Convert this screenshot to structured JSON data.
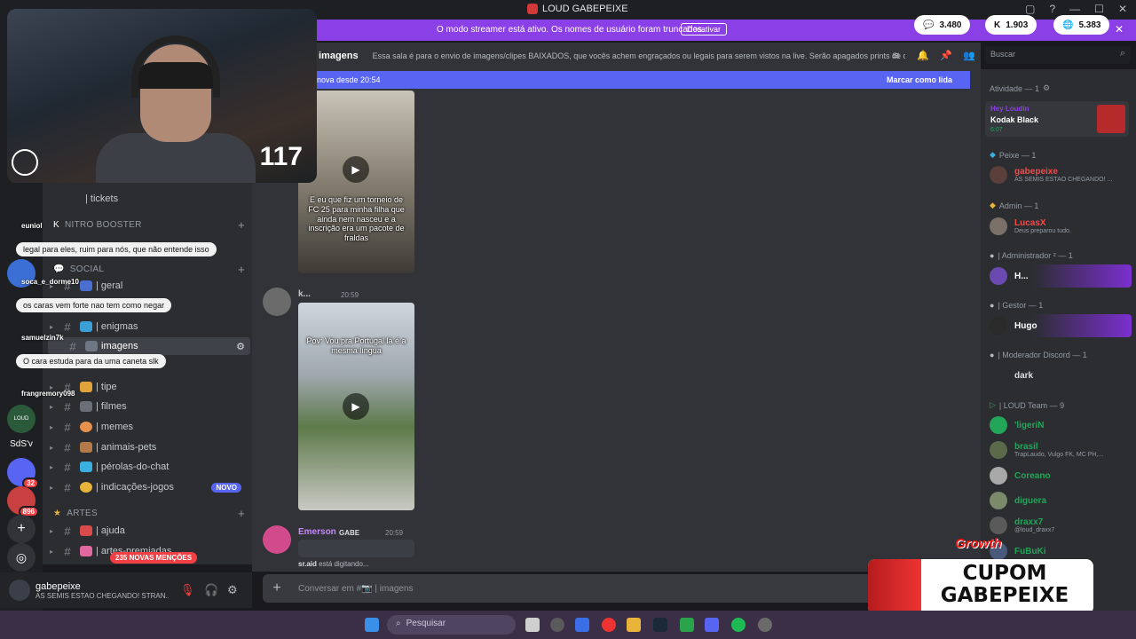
{
  "window": {
    "title": "LOUD GABEPEIXE"
  },
  "streamer_banner": {
    "message": "O modo streamer está ativo. Os nomes de usuário foram truncados.",
    "button": "Desativar"
  },
  "stats": [
    {
      "icon": "chat-icon",
      "value": "3.480"
    },
    {
      "icon": "kick-icon",
      "value": "1.903"
    },
    {
      "icon": "globe-icon",
      "value": "5.383"
    }
  ],
  "webcam": {
    "viewer_count": "117"
  },
  "channel_header": {
    "name": "imagens",
    "topic": "Essa sala é para o envio de imagens/clipes BAIXADOS, que vocês achem engraçados ou legais para serem vistos na live. Serão apagados prints de o..."
  },
  "search": {
    "placeholder": "Buscar"
  },
  "new_messages_bar": {
    "left": "nova desde 20:54",
    "right": "Marcar como lida"
  },
  "sidebar": {
    "tickets": "| tickets",
    "categories": {
      "nitro": "NITRO BOOSTER",
      "social": "SOCIAL",
      "artes": "ARTES"
    },
    "channels": [
      {
        "name": "| geral"
      },
      {
        "name": "| enigmas"
      },
      {
        "name": "imagens"
      },
      {
        "name": "| tipe"
      },
      {
        "name": "| filmes"
      },
      {
        "name": "| memes"
      },
      {
        "name": "| animais-pets"
      },
      {
        "name": "| pérolas-do-chat"
      },
      {
        "name": "| indicações-jogos",
        "badge": "NOVO"
      },
      {
        "name": "| ajuda"
      },
      {
        "name": "| artes-premiadas"
      }
    ],
    "mentions": "235 NOVAS MENÇÕES"
  },
  "server_badges": {
    "a": "32",
    "b": "896"
  },
  "server_labels": {
    "sdsv": "SdS'v",
    "loud": "LOUD"
  },
  "chat_overlay": [
    {
      "user": "euniol",
      "message": "legal para eles, ruim para nós, que não entende isso"
    },
    {
      "user": "soca_e_dorme10",
      "message": "os caras vem forte nao tem como negar"
    },
    {
      "user": "samuelzin7k",
      "message": "O cara estuda para da uma caneta slk"
    },
    {
      "user": "frangremory098",
      "message": ""
    }
  ],
  "messages": [
    {
      "caption": "E eu que fiz um torneio de FC 25 para minha filha que ainda nem nasceu e a inscrição era um pacote de fraldas"
    },
    {
      "author": "k...",
      "time": "20:59",
      "caption": "Pov: Vou pra Portugal lá é a mesma língua"
    },
    {
      "author": "Emerson",
      "tag": "GABE",
      "time": "20:59"
    }
  ],
  "typing": {
    "user": "sr.aid",
    "text": "está digitando..."
  },
  "composer": {
    "placeholder": "Conversar em #📷 | imagens"
  },
  "user_panel": {
    "name": "gabepeixe",
    "status": "AS SEMIS ESTAO CHEGANDO! STRAN..."
  },
  "members": {
    "activity_header": "Atividade — 1",
    "activity": {
      "user": "Hey Loudin",
      "song": "Kodak Black",
      "duration": "6:07"
    },
    "groups": [
      {
        "header": "Peixe — 1",
        "items": [
          {
            "name": "gabepeixe",
            "sub": "AS SEMIS ESTAO CHEGANDO! ..."
          }
        ]
      },
      {
        "header": "Admin — 1",
        "items": [
          {
            "name": "LucasX",
            "sub": "Deus preparou tudo."
          }
        ]
      },
      {
        "header": "| Administrador ² — 1",
        "items": [
          {
            "name": "H...",
            "sub": ""
          }
        ]
      },
      {
        "header": "| Gestor — 1",
        "items": [
          {
            "name": "Hugo",
            "sub": ""
          }
        ]
      },
      {
        "header": "| Moderador Discord — 1",
        "items": [
          {
            "name": "dark",
            "sub": ""
          }
        ]
      },
      {
        "header": "| LOUD Team — 9",
        "items": [
          {
            "name": "'ligeriN",
            "sub": ""
          },
          {
            "name": "brasil",
            "sub": "TrapLaudo, Vulgo FK, MC PH,..."
          },
          {
            "name": "Coreano",
            "sub": ""
          },
          {
            "name": "diguera",
            "sub": ""
          },
          {
            "name": "draxx7",
            "sub": "@loud_draxx7"
          },
          {
            "name": "FuBuKi",
            "sub": ""
          }
        ]
      }
    ]
  },
  "overlay_ads": {
    "brand": "Growth",
    "coupon": "CUPOM GABEPEIXE"
  },
  "taskbar": {
    "search": "Pesquisar"
  },
  "colors": {
    "accent": "#8b3fe6",
    "blurple": "#5865f2",
    "online": "#23a55a",
    "badge": "#f23f43"
  }
}
